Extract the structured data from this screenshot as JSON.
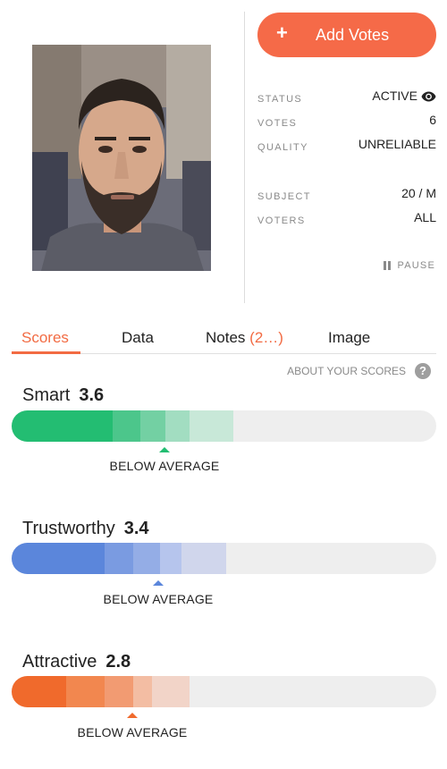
{
  "actions": {
    "add_votes_label": "Add Votes",
    "add_icon": "plus-icon",
    "pause_label": "PAUSE",
    "pause_icon": "pause-icon"
  },
  "status": [
    {
      "key": "STATUS",
      "value": "ACTIVE",
      "icon": "eye-icon"
    },
    {
      "key": "VOTES",
      "value": "6"
    },
    {
      "key": "QUALITY",
      "value": "UNRELIABLE"
    },
    {
      "key": "SUBJECT",
      "value": "20 / M"
    },
    {
      "key": "VOTERS",
      "value": "ALL"
    }
  ],
  "tabs": [
    {
      "label": "Scores",
      "active": true
    },
    {
      "label": "Data"
    },
    {
      "label": "Notes",
      "count": "(2…)"
    },
    {
      "label": "Image"
    }
  ],
  "about_scores": {
    "label": "ABOUT YOUR SCORES",
    "icon": "question-icon"
  },
  "scores": [
    {
      "name": "Smart",
      "value": "3.6",
      "comparison": "BELOW AVERAGE",
      "colors": [
        "#23bd72",
        "#4cc68b",
        "#73d0a3",
        "#a2ddc1",
        "#c8e8d8"
      ]
    },
    {
      "name": "Trustworthy",
      "value": "3.4",
      "comparison": "BELOW AVERAGE",
      "colors": [
        "#5b86db",
        "#7a9be1",
        "#94ade6",
        "#b6c5ed",
        "#d0d6ec"
      ]
    },
    {
      "name": "Attractive",
      "value": "2.8",
      "comparison": "BELOW AVERAGE",
      "colors": [
        "#f06a2c",
        "#f2874f",
        "#f29b72",
        "#f3bda3",
        "#f2d4c8"
      ]
    }
  ]
}
